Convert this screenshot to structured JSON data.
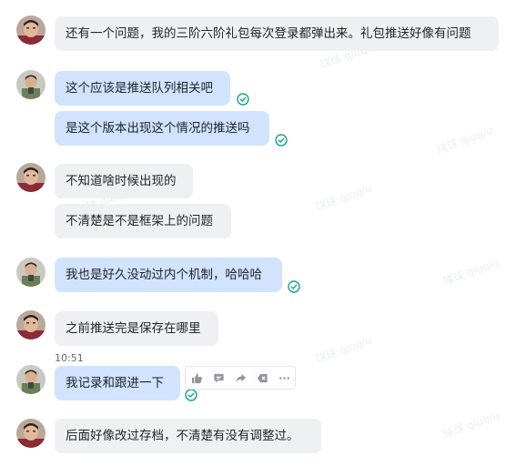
{
  "watermark": "球球 qiuqiu",
  "messages": [
    {
      "text": "还有一个问题，我的三阶六阶礼包每次登录都弹出来。礼包推送好像有问题",
      "sender": "other"
    },
    {
      "text": "这个应该是推送队列相关吧",
      "sender": "self"
    },
    {
      "text": "是这个版本出现这个情况的推送吗",
      "sender": "self"
    },
    {
      "text": "不知道啥时候出现的",
      "sender": "other"
    },
    {
      "text": "不清楚是不是框架上的问题",
      "sender": "other"
    },
    {
      "text": "我也是好久没动过内个机制，哈哈哈",
      "sender": "self"
    },
    {
      "text": "之前推送完是保存在哪里",
      "sender": "other"
    },
    {
      "text": "我记录和跟进一下",
      "sender": "self"
    },
    {
      "text": "后面好像改过存档，不清楚有没有调整过。",
      "sender": "other"
    }
  ],
  "timestamp": "10:51",
  "toolbar": {
    "actions": [
      "thumbs-up-icon",
      "comment-icon",
      "forward-icon",
      "tag-icon",
      "more-icon"
    ]
  },
  "colors": {
    "bubble_other": "#eff0f1",
    "bubble_self": "#d1e3ff",
    "read_check": "#14a38b"
  }
}
